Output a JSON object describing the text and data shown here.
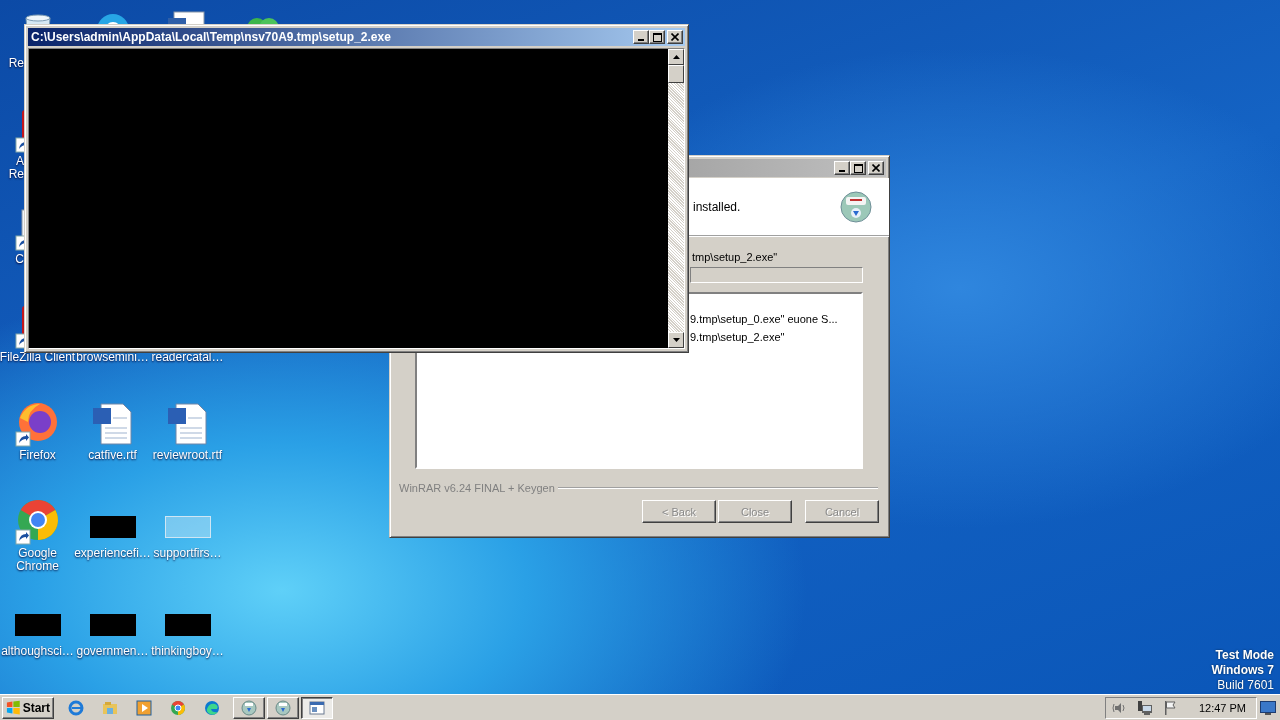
{
  "desktop": {
    "columns": [
      [
        {
          "kind": "recycle-bin",
          "label": [
            "Re"
          ],
          "cut": true
        },
        {
          "kind": "red-app",
          "label": [
            "A",
            "Re"
          ],
          "cut": true,
          "shortcut": true
        },
        {
          "kind": "page-app",
          "label": [
            "C"
          ],
          "cut": true,
          "shortcut": true
        },
        {
          "kind": "red-app",
          "label": [
            "FileZilla Client"
          ],
          "shortcut": true
        },
        {
          "kind": "firefox",
          "label": [
            "Firefox"
          ],
          "shortcut": true
        },
        {
          "kind": "chrome",
          "label": [
            "Google",
            "Chrome"
          ],
          "shortcut": true
        },
        {
          "kind": "thumbnail-dark",
          "label": [
            "althoughsci…"
          ]
        }
      ],
      [
        {
          "kind": "blue-app"
        },
        null,
        null,
        {
          "kind": "none",
          "label": [
            "browsemini…"
          ]
        },
        {
          "kind": "word",
          "label": [
            "catfive.rtf"
          ]
        },
        {
          "kind": "thumbnail-dark",
          "label": [
            "experiencefi…"
          ]
        },
        {
          "kind": "thumbnail-dark",
          "label": [
            "governmen…"
          ]
        }
      ],
      [
        {
          "kind": "document"
        },
        null,
        null,
        {
          "kind": "none",
          "label": [
            "readercatal…"
          ]
        },
        {
          "kind": "word",
          "label": [
            "reviewroot.rtf"
          ]
        },
        {
          "kind": "thumbnail-light",
          "label": [
            "supportfirs…"
          ]
        },
        {
          "kind": "thumbnail-dark",
          "label": [
            "thinkingboy…"
          ]
        }
      ],
      [
        {
          "kind": "green-app"
        }
      ]
    ],
    "test_mode": [
      "Test Mode",
      "Windows 7",
      "Build 7601"
    ]
  },
  "installer_dialog": {
    "active": false,
    "header_text": "installed.",
    "status_text": "tmp\\setup_2.exe\"",
    "progress": {
      "level": 0
    },
    "log": [
      "9.tmp\\setup_0.exe\" euone S...",
      "9.tmp\\setup_2.exe\""
    ],
    "branding": "WinRAR v6.24 FINAL + Keygen",
    "buttons": [
      {
        "label": "< Back",
        "disabled": true
      },
      {
        "label": "Close",
        "disabled": true
      },
      {
        "label": "Cancel",
        "disabled": true
      }
    ]
  },
  "console_window": {
    "active": true,
    "title": "C:\\Users\\admin\\AppData\\Local\\Temp\\nsv70A9.tmp\\setup_2.exe"
  },
  "taskbar": {
    "start": "Start",
    "quick_launch": [
      {
        "kind": "ie"
      },
      {
        "kind": "explorer"
      },
      {
        "kind": "media"
      },
      {
        "kind": "chrome"
      },
      {
        "kind": "edge"
      }
    ],
    "tasks": [
      {
        "kind": "installer",
        "selected": false
      },
      {
        "kind": "installer",
        "selected": false
      },
      {
        "kind": "console",
        "selected": true
      }
    ],
    "tray": [
      {
        "kind": "volume"
      },
      {
        "kind": "network"
      },
      {
        "kind": "flag"
      }
    ],
    "clock": "12:47 PM"
  }
}
